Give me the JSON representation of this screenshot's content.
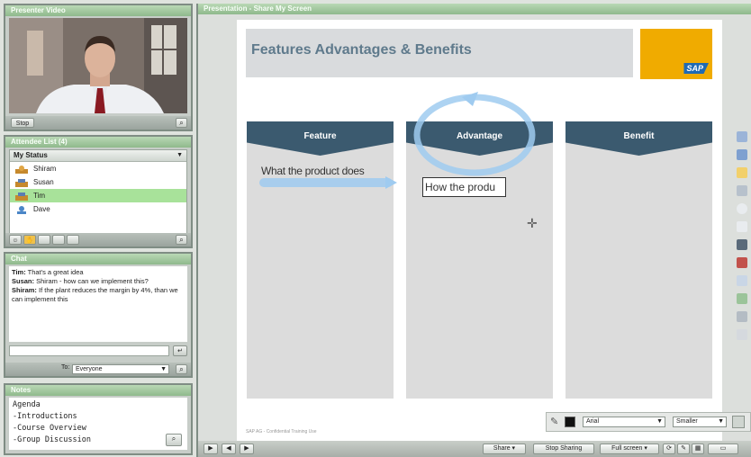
{
  "video_pod": {
    "title": "Presenter Video",
    "footer_button": "Stop"
  },
  "attendees_pod": {
    "title": "Attendee List (4)",
    "status_header": "My Status",
    "attendees": [
      {
        "name": "Shiram",
        "selected": false,
        "icon": "presenter-icon"
      },
      {
        "name": "Susan",
        "selected": false,
        "icon": "host-icon"
      },
      {
        "name": "Tim",
        "selected": true,
        "icon": "host-icon"
      },
      {
        "name": "Dave",
        "selected": false,
        "icon": "participant-icon"
      }
    ]
  },
  "chat_pod": {
    "title": "Chat",
    "messages": [
      {
        "sender": "Tim:",
        "text": "That's a great idea"
      },
      {
        "sender": "Susan:",
        "text": "Shiram - how can we implement this?"
      },
      {
        "sender": "Shiram:",
        "text": "If the plant reduces the margin by 4%, than we can implement this"
      }
    ],
    "input_placeholder": "",
    "to_label": "To:",
    "to_value": "Everyone"
  },
  "notes_pod": {
    "title": "Notes",
    "lines": [
      "Agenda",
      "-Introductions",
      "-Course Overview",
      "-Group Discussion"
    ]
  },
  "share_pod": {
    "title": "Presentation - Share My Screen",
    "slide": {
      "title": "Features Advantages & Benefits",
      "logo_text": "SAP",
      "columns": [
        "Feature",
        "Advantage",
        "Benefit"
      ],
      "feature_text": "What the product does",
      "advantage_box_text": "How the produ",
      "footer_text": "SAP AG - Confidential Training Use"
    },
    "bottom_bar": {
      "share_label": "Share",
      "stop_sharing_label": "Stop Sharing",
      "fullscreen_label": "Full screen"
    },
    "draw_toolbar": {
      "font": "Arial",
      "size": "Smaller"
    },
    "colors": {
      "slide_header": "#3b5a6f",
      "highlight_blue": "#9fcbf0",
      "sap_yellow": "#f0ab00"
    }
  }
}
